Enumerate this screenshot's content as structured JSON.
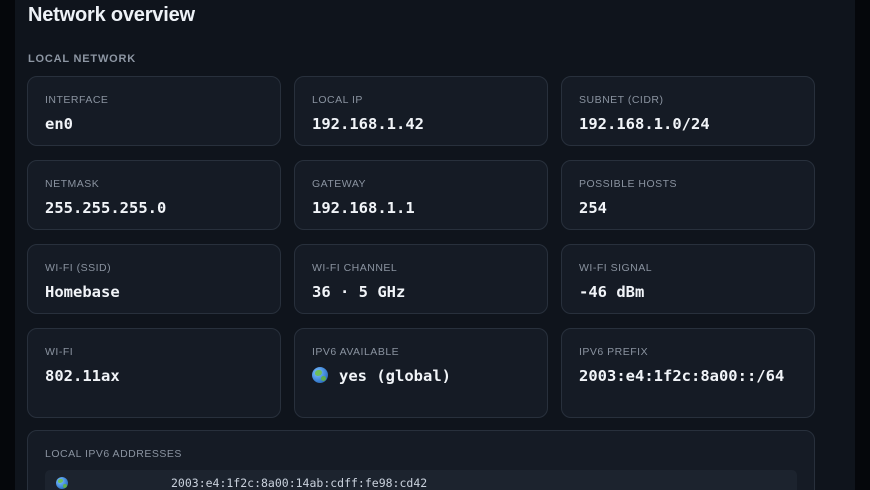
{
  "page": {
    "title": "Network overview"
  },
  "section": {
    "label": "LOCAL NETWORK"
  },
  "cards": [
    {
      "label": "INTERFACE",
      "value": "en0"
    },
    {
      "label": "LOCAL IP",
      "value": "192.168.1.42"
    },
    {
      "label": "SUBNET (CIDR)",
      "value": "192.168.1.0/24"
    },
    {
      "label": "NETMASK",
      "value": "255.255.255.0"
    },
    {
      "label": "GATEWAY",
      "value": "192.168.1.1"
    },
    {
      "label": "POSSIBLE HOSTS",
      "value": "254"
    },
    {
      "label": "WI-FI (SSID)",
      "value": "Homebase"
    },
    {
      "label": "WI-FI CHANNEL",
      "value": "36 · 5 GHz"
    },
    {
      "label": "WI-FI SIGNAL",
      "value": "-46 dBm"
    },
    {
      "label": "WI-FI",
      "value": "802.11ax"
    },
    {
      "label": "IPV6 AVAILABLE",
      "value": "yes (global)",
      "icon": "globe-icon"
    },
    {
      "label": "IPV6 PREFIX",
      "value": "2003:e4:1f2c:8a00::/64"
    }
  ],
  "ipv6": {
    "label": "LOCAL IPV6 ADDRESSES",
    "addresses": [
      {
        "icon": "globe-icon",
        "address": "2003:e4:1f2c:8a00:14ab:cdff:fe98:cd42"
      }
    ]
  }
}
